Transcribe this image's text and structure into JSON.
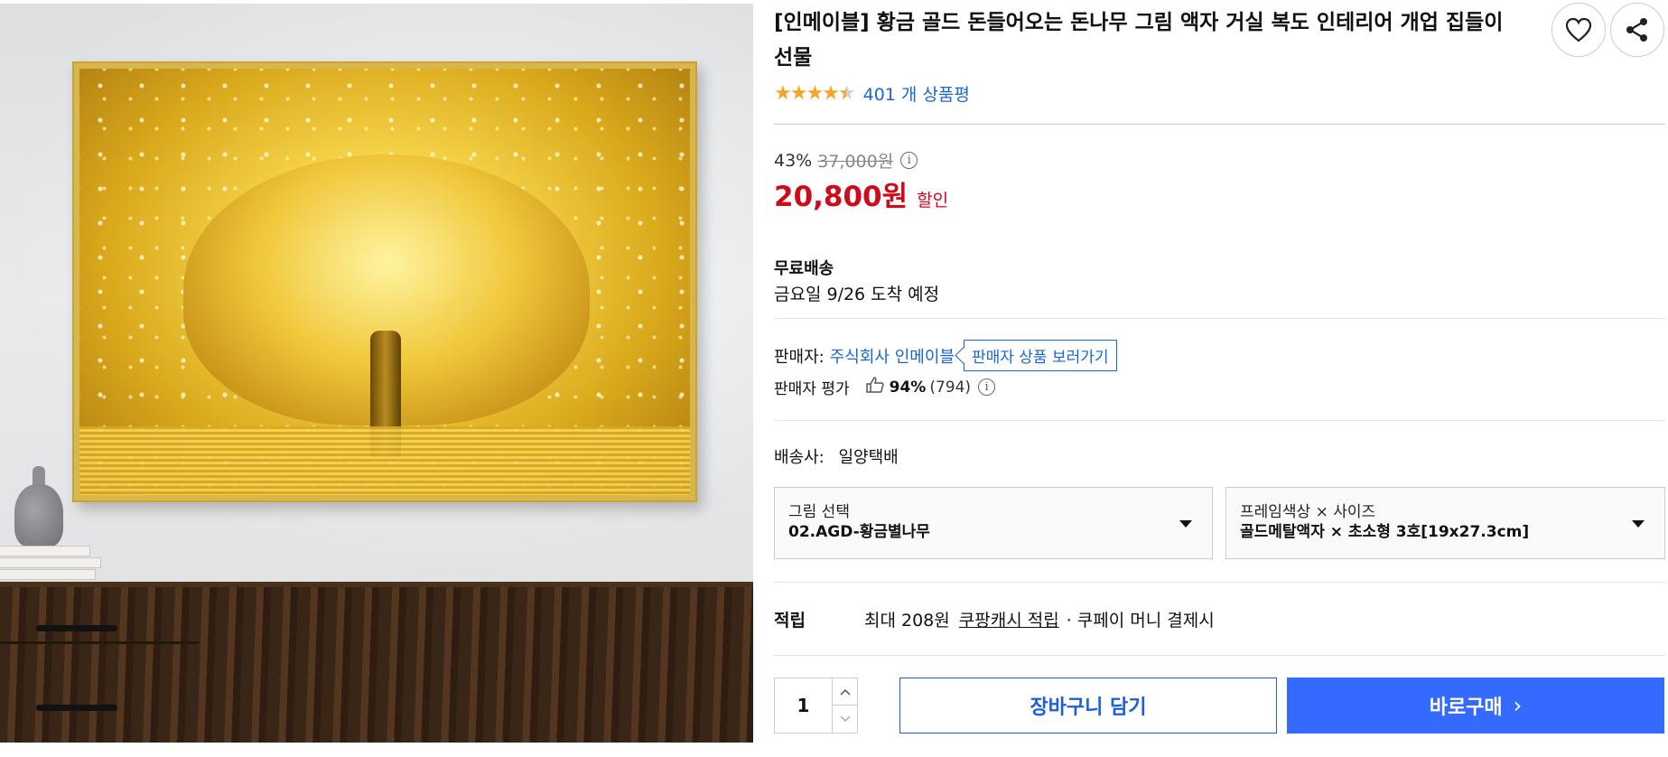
{
  "product": {
    "title": "[인메이블] 황금 골드 돈들어오는 돈나무 그림 액자 거실 복도 인테리어 개업 집들이 선물",
    "rating_value": 4.5,
    "review_count": "401 개 상품평",
    "image_icon": "golden-tree-painting"
  },
  "actions": {
    "wishlist_icon": "heart-icon",
    "share_icon": "share-icon"
  },
  "price": {
    "discount_rate": "43%",
    "original_price": "37,000원",
    "info_glyph": "i",
    "sale_price": "20,800원",
    "sale_label": "할인"
  },
  "shipping": {
    "title": "무료배송",
    "eta": "금요일 9/26 도착 예정"
  },
  "seller": {
    "label": "판매자:",
    "name": "주식회사 인메이블",
    "link_label": "판매자 상품 보러가기",
    "rating_label": "판매자 평가",
    "rating_pct": "94%",
    "rating_count": "(794)",
    "info_glyph": "i"
  },
  "carrier": {
    "label": "배송사:",
    "name": "일양택배"
  },
  "options": [
    {
      "label": "그림 선택",
      "value": "02.AGD-황금별나무"
    },
    {
      "label": "프레임색상 × 사이즈",
      "value": "골드메탈액자 × 초소형 3호[19x27.3cm]"
    }
  ],
  "reward": {
    "title": "적립",
    "text": "최대 208원",
    "link": "쿠팡캐시 적립",
    "suffix": "· 쿠페이 머니 결제시"
  },
  "purchase": {
    "quantity": "1",
    "cart_label": "장바구니 담기",
    "buy_label": "바로구매",
    "buy_chevron": "›"
  },
  "colors": {
    "sale_red": "#d10a1b",
    "link_blue": "#1a66d6",
    "buy_blue": "#346aff",
    "star_orange": "#f5a623"
  }
}
